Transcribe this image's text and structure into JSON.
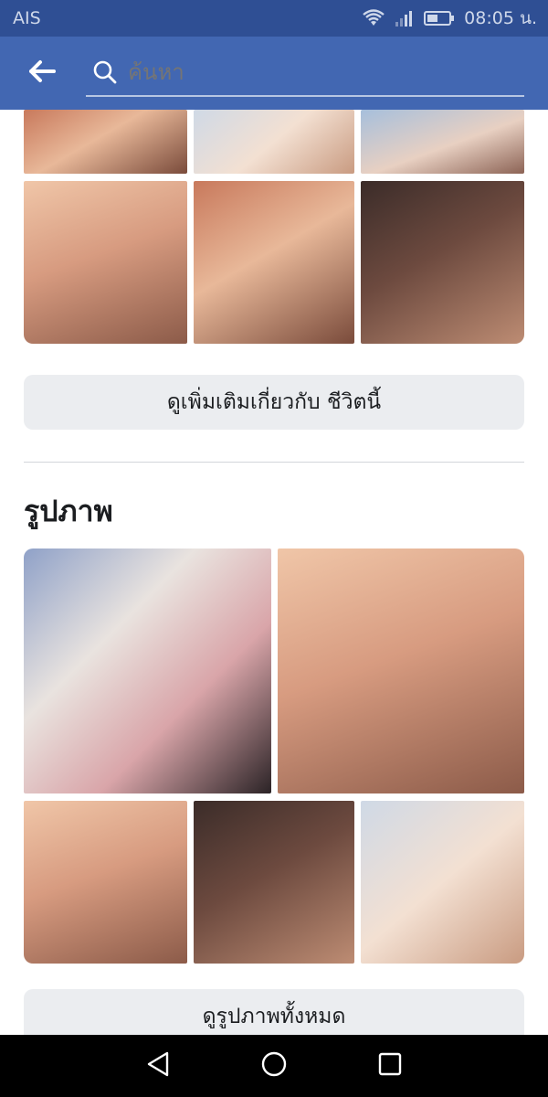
{
  "status_bar": {
    "carrier": "AIS",
    "time": "08:05 น.",
    "icons": [
      "wifi-icon",
      "signal-icon",
      "battery-icon"
    ]
  },
  "app_bar": {
    "back_icon": "arrow-left-icon",
    "search_icon": "search-icon",
    "search_placeholder": "ค้นหา"
  },
  "life_section": {
    "see_more_label": "ดูเพิ่มเติมเกี่ยวกับ ชีวิตนี้"
  },
  "photos_section": {
    "title": "รูปภาพ",
    "see_all_label": "ดูรูปภาพทั้งหมด"
  },
  "nav_bar": {
    "icons": [
      "back-triangle-icon",
      "home-circle-icon",
      "recents-square-icon"
    ]
  },
  "colors": {
    "status_bar": "#2f4f94",
    "app_bar": "#4267b2",
    "button_bg": "#ebedf0",
    "text": "#1c1e21"
  }
}
